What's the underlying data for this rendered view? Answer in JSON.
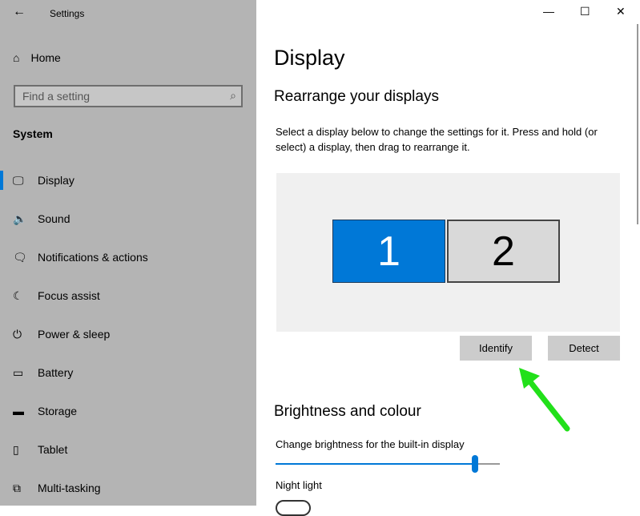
{
  "window": {
    "title": "Settings",
    "minimize": "—",
    "maximize": "☐",
    "close": "✕"
  },
  "sidebar": {
    "home": "Home",
    "search_placeholder": "Find a setting",
    "section": "System",
    "items": [
      {
        "label": "Display",
        "icon": "🖵",
        "selected": true
      },
      {
        "label": "Sound",
        "icon": "🔈"
      },
      {
        "label": "Notifications & actions",
        "icon": "🗨"
      },
      {
        "label": "Focus assist",
        "icon": "☾"
      },
      {
        "label": "Power & sleep",
        "icon": "⏻"
      },
      {
        "label": "Battery",
        "icon": "▭"
      },
      {
        "label": "Storage",
        "icon": "▬"
      },
      {
        "label": "Tablet",
        "icon": "▯"
      },
      {
        "label": "Multi-tasking",
        "icon": "⧉"
      }
    ]
  },
  "main": {
    "title": "Display",
    "rearrange": {
      "heading": "Rearrange your displays",
      "description": "Select a display below to change the settings for it. Press and hold (or select) a display, then drag to rearrange it.",
      "displays": [
        "1",
        "2"
      ],
      "selected": "1",
      "identify": "Identify",
      "detect": "Detect"
    },
    "brightness": {
      "heading": "Brightness and colour",
      "label": "Change brightness for the built-in display",
      "value": 0.89,
      "night_light": "Night light"
    }
  },
  "colors": {
    "accent": "#0078d7",
    "annotation_arrow": "#22e01a"
  }
}
